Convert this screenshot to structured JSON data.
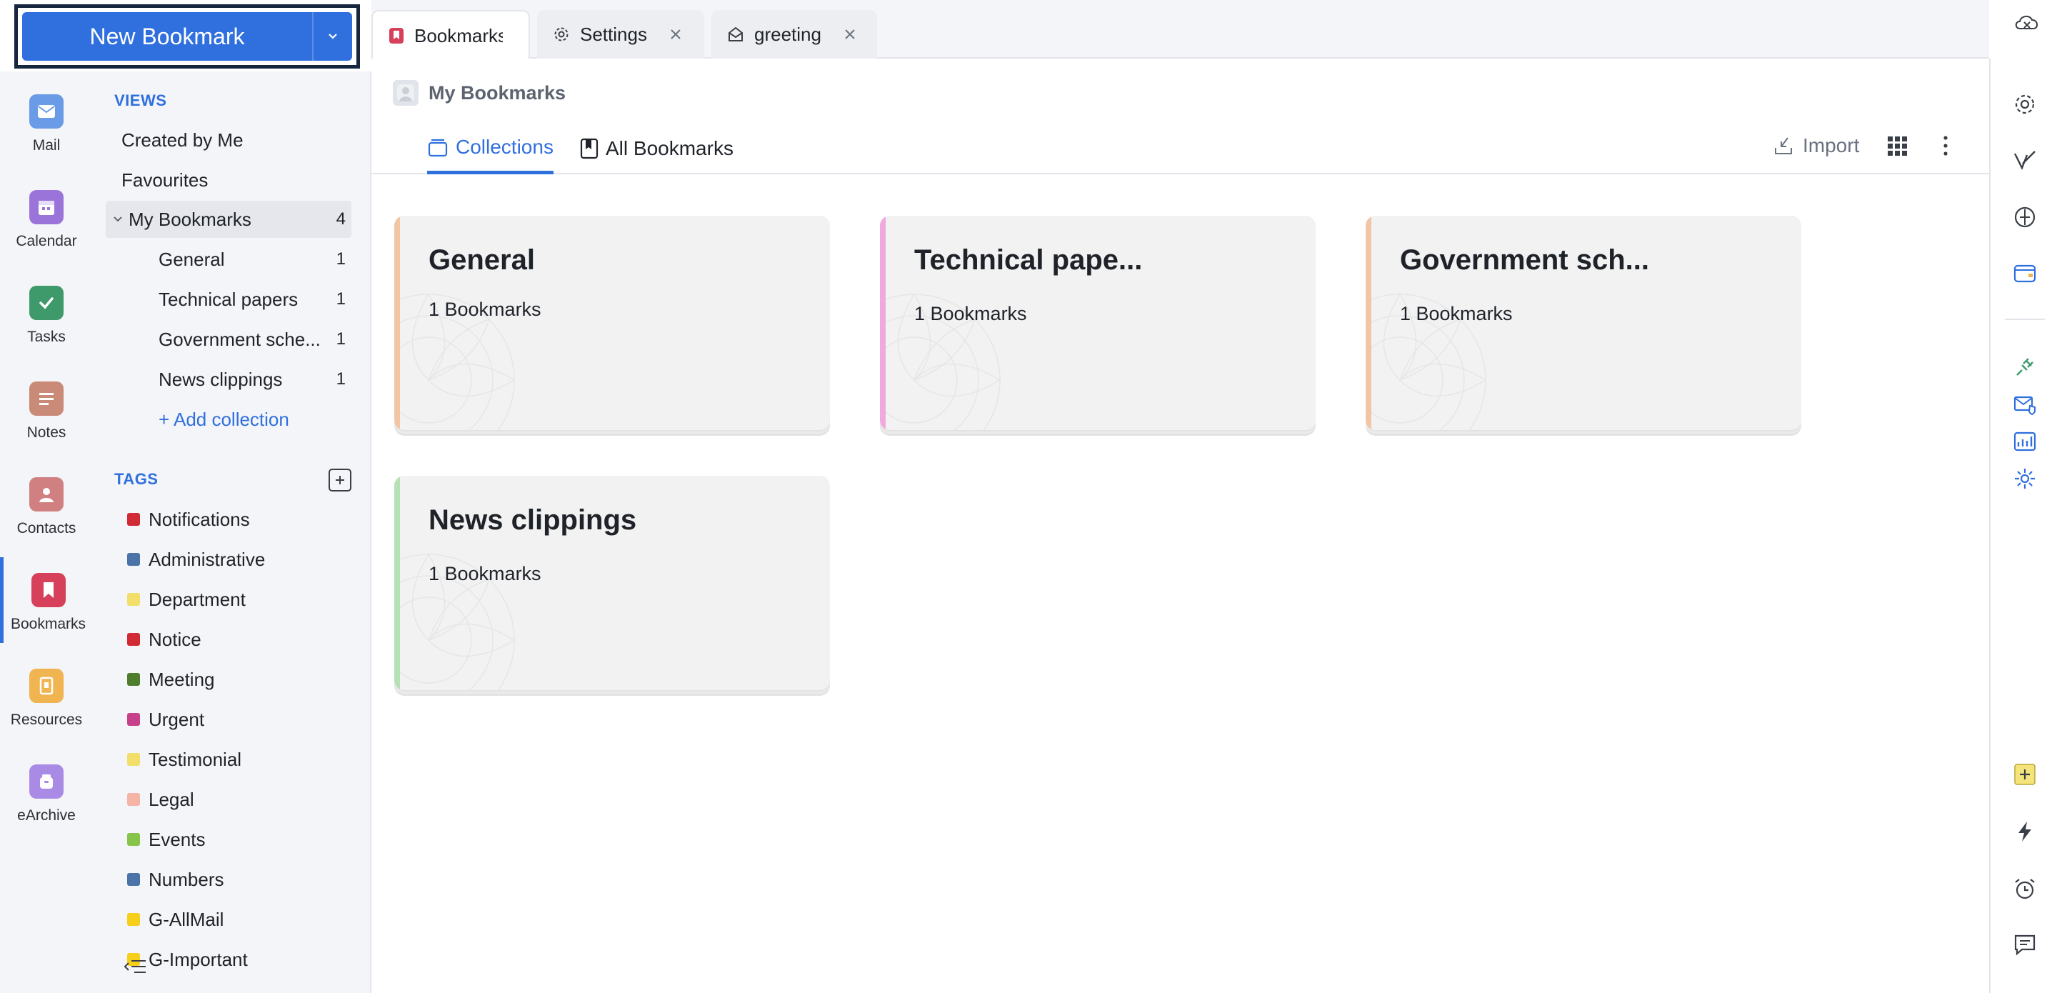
{
  "new_bookmark": {
    "label": "New Bookmark"
  },
  "rail": [
    {
      "label": "Mail",
      "icon": "mail-icon",
      "color": "#6a9be6"
    },
    {
      "label": "Calendar",
      "icon": "calendar-icon",
      "color": "#9b74d9"
    },
    {
      "label": "Tasks",
      "icon": "tasks-icon",
      "color": "#3e9a6a"
    },
    {
      "label": "Notes",
      "icon": "notes-icon",
      "color": "#c98a78"
    },
    {
      "label": "Contacts",
      "icon": "contacts-icon",
      "color": "#d08080"
    },
    {
      "label": "Bookmarks",
      "icon": "bookmarks-icon",
      "color": "#d6405a"
    },
    {
      "label": "Resources",
      "icon": "resources-icon",
      "color": "#f0b450"
    },
    {
      "label": "eArchive",
      "icon": "earchive-icon",
      "color": "#a98be6"
    }
  ],
  "views": {
    "title": "VIEWS",
    "created_by_me": "Created by Me",
    "favourites": "Favourites",
    "my_bookmarks": {
      "label": "My Bookmarks",
      "count": "4"
    },
    "collections": [
      {
        "label": "General",
        "count": "1"
      },
      {
        "label": "Technical papers",
        "count": "1"
      },
      {
        "label": "Government sche...",
        "count": "1"
      },
      {
        "label": "News clippings",
        "count": "1"
      }
    ],
    "add_collection": "+ Add collection"
  },
  "tags": {
    "title": "TAGS",
    "items": [
      {
        "label": "Notifications",
        "color": "#d12a35"
      },
      {
        "label": "Administrative",
        "color": "#4a74a8"
      },
      {
        "label": "Department",
        "color": "#f1df6a"
      },
      {
        "label": "Notice",
        "color": "#d12a35"
      },
      {
        "label": "Meeting",
        "color": "#4f7d2e"
      },
      {
        "label": "Urgent",
        "color": "#c7408a"
      },
      {
        "label": "Testimonial",
        "color": "#f1df6a"
      },
      {
        "label": "Legal",
        "color": "#f4b4a6"
      },
      {
        "label": "Events",
        "color": "#86c44a"
      },
      {
        "label": "Numbers",
        "color": "#4a74a8"
      },
      {
        "label": "G-AllMail",
        "color": "#f5cf1a"
      },
      {
        "label": "G-Important",
        "color": "#f5cf1a"
      }
    ]
  },
  "tabs": [
    {
      "label": "Bookmarks",
      "active": true
    },
    {
      "label": "Settings"
    },
    {
      "label": "greeting"
    }
  ],
  "breadcrumb": "My Bookmarks",
  "view_tabs": {
    "collections": "Collections",
    "all": "All Bookmarks"
  },
  "toolbar": {
    "import": "Import"
  },
  "cards": [
    {
      "title": "General",
      "subtitle": "1 Bookmarks",
      "accent": "#f2c6a4"
    },
    {
      "title": "Technical pape...",
      "subtitle": "1 Bookmarks",
      "accent": "#f0a9de"
    },
    {
      "title": "Government sch...",
      "subtitle": "1 Bookmarks",
      "accent": "#f2c6a4"
    },
    {
      "title": "News clippings",
      "subtitle": "1 Bookmarks",
      "accent": "#b6e0b6"
    }
  ],
  "accent": "#2f6fde"
}
